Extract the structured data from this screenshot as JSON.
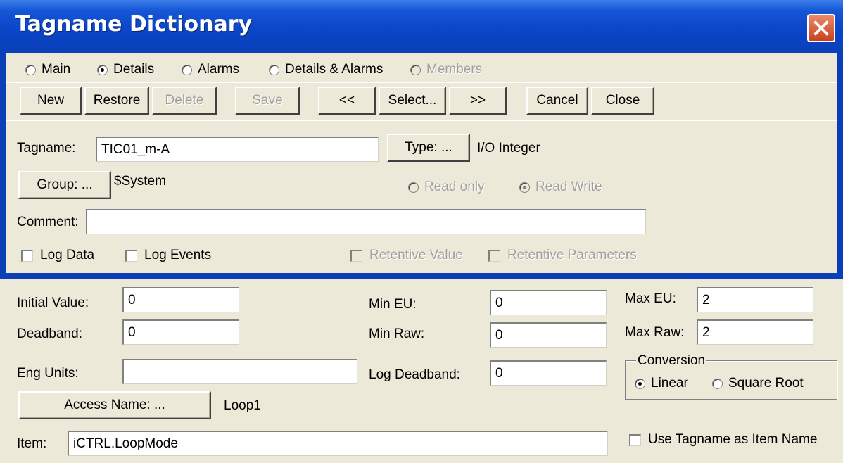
{
  "window": {
    "title": "Tagname Dictionary"
  },
  "view_options": [
    {
      "label": "Main",
      "selected": false,
      "enabled": true
    },
    {
      "label": "Details",
      "selected": true,
      "enabled": true
    },
    {
      "label": "Alarms",
      "selected": false,
      "enabled": true
    },
    {
      "label": "Details & Alarms",
      "selected": false,
      "enabled": true
    },
    {
      "label": "Members",
      "selected": false,
      "enabled": false
    }
  ],
  "toolbar": {
    "new": "New",
    "restore": "Restore",
    "delete": "Delete",
    "save": "Save",
    "prev": "<<",
    "select": "Select...",
    "next": ">>",
    "cancel": "Cancel",
    "close": "Close"
  },
  "tag": {
    "tagname_label": "Tagname:",
    "tagname_value": "TIC01_m-A",
    "type_button": "Type: ...",
    "type_value": "I/O Integer",
    "group_button": "Group: ...",
    "group_value": "$System",
    "read_only": "Read only",
    "read_write": "Read Write",
    "comment_label": "Comment:",
    "comment_value": "",
    "log_data": "Log Data",
    "log_events": "Log Events",
    "retentive_value": "Retentive Value",
    "retentive_parameters": "Retentive Parameters"
  },
  "details": {
    "initial_value_label": "Initial Value:",
    "initial_value": "0",
    "deadband_label": "Deadband:",
    "deadband": "0",
    "eng_units_label": "Eng Units:",
    "eng_units": "",
    "min_eu_label": "Min EU:",
    "min_eu": "0",
    "min_raw_label": "Min Raw:",
    "min_raw": "0",
    "log_deadband_label": "Log Deadband:",
    "log_deadband": "0",
    "max_eu_label": "Max EU:",
    "max_eu": "2",
    "max_raw_label": "Max Raw:",
    "max_raw": "2",
    "conversion_label": "Conversion",
    "linear": "Linear",
    "square_root": "Square Root",
    "access_name_button": "Access Name: ...",
    "access_name_value": "Loop1",
    "item_label": "Item:",
    "item_value": "iCTRL.LoopMode",
    "use_tagname": "Use Tagname as Item Name"
  },
  "colors": {
    "title_bar": "#0b3fb8",
    "window_bg": "#ece9d8",
    "close_button": "#c8431f"
  }
}
